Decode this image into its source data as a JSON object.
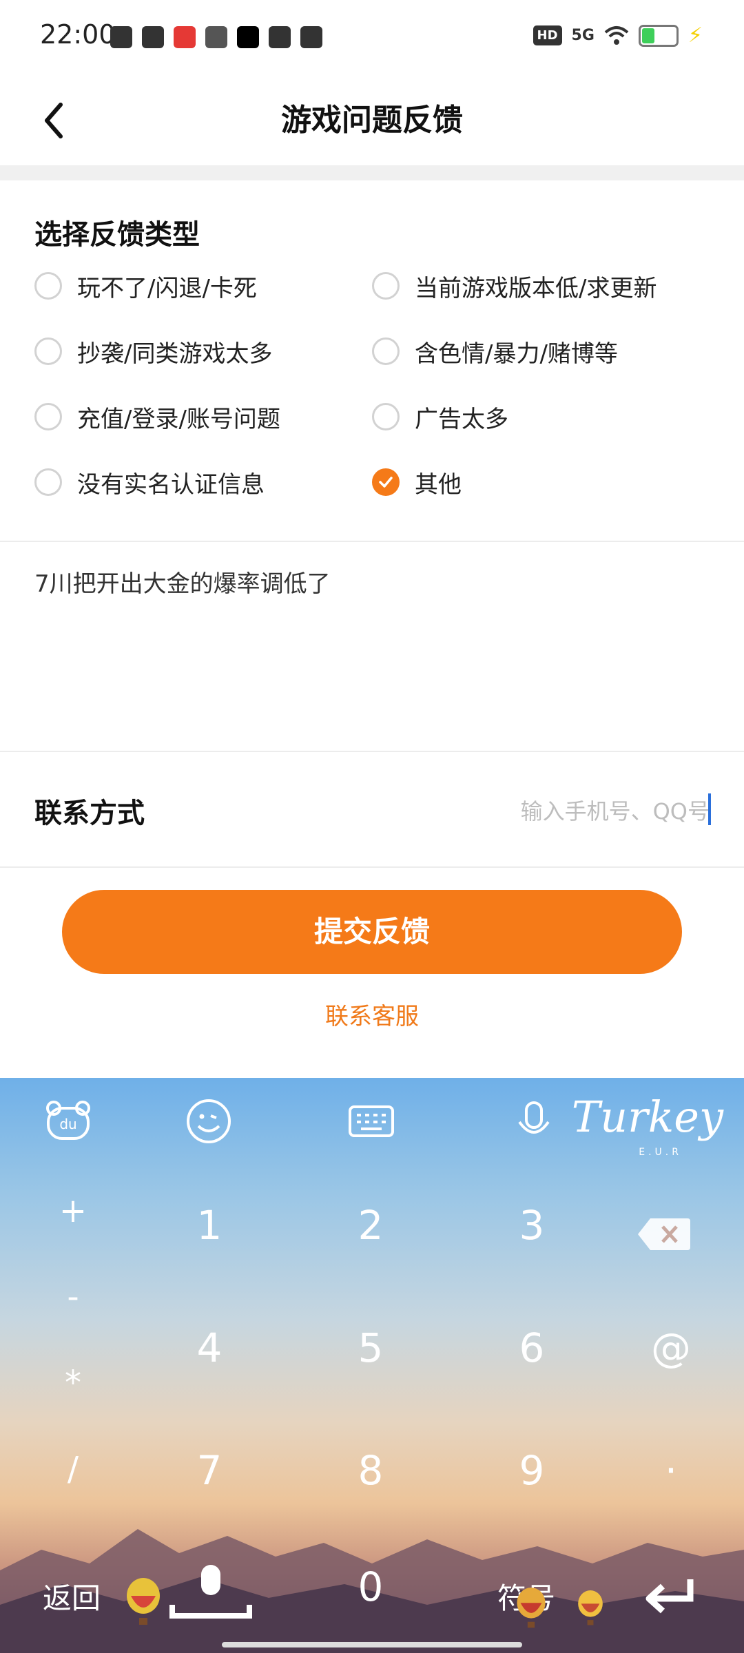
{
  "status_bar": {
    "time": "22:00",
    "hd_badge": "HD",
    "network": "5G",
    "battery_level": "35",
    "icons": [
      "douyin-icon",
      "du-icon",
      "heart-app-icon",
      "leaf-app-icon",
      "star-app-icon",
      "bus-app-icon",
      "card-app-icon",
      "wifi-icon",
      "battery-icon",
      "charging-icon"
    ]
  },
  "header": {
    "title": "游戏问题反馈"
  },
  "feedback_type": {
    "title": "选择反馈类型",
    "options": [
      {
        "label": "玩不了/闪退/卡死",
        "checked": false
      },
      {
        "label": "当前游戏版本低/求更新",
        "checked": false
      },
      {
        "label": "抄袭/同类游戏太多",
        "checked": false
      },
      {
        "label": "含色情/暴力/赌博等",
        "checked": false
      },
      {
        "label": "充值/登录/账号问题",
        "checked": false
      },
      {
        "label": "广告太多",
        "checked": false
      },
      {
        "label": "没有实名认证信息",
        "checked": false
      },
      {
        "label": "其他",
        "checked": true
      }
    ]
  },
  "feedback_text": "7川把开出大金的爆率调低了",
  "contact": {
    "label": "联系方式",
    "placeholder": "输入手机号、QQ号",
    "value": ""
  },
  "submit_label": "提交反馈",
  "service_link": "联系客服",
  "keyboard": {
    "brand": "Turkey",
    "brand_sub": "E.U.R",
    "symbols_left": [
      "+",
      "-",
      "*",
      "/"
    ],
    "digits": [
      "1",
      "2",
      "3",
      "4",
      "5",
      "6",
      "7",
      "8",
      "9",
      "0"
    ],
    "right_keys": [
      "@",
      "·"
    ],
    "back_label": "返回",
    "symbols_label": "符号",
    "colors": {
      "accent": "#f57a18",
      "link": "#f07a1a",
      "caret": "#2a6fdb"
    }
  }
}
